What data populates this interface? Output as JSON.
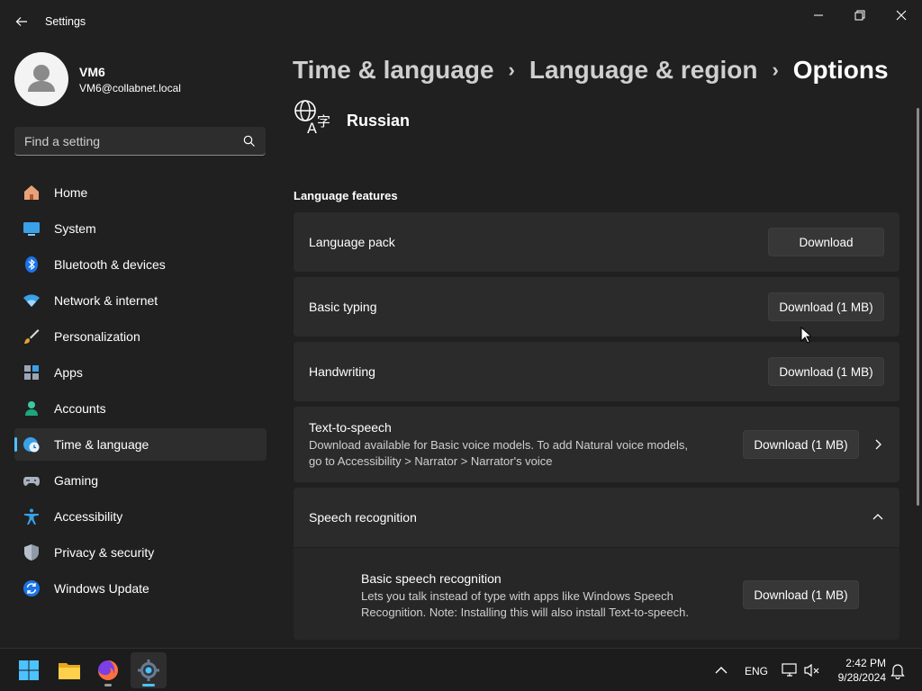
{
  "window": {
    "title": "Settings"
  },
  "profile": {
    "name": "VM6",
    "email": "VM6@collabnet.local"
  },
  "search": {
    "placeholder": "Find a setting"
  },
  "sidebar": {
    "items": [
      {
        "label": "Home",
        "icon": "home-icon"
      },
      {
        "label": "System",
        "icon": "system-icon"
      },
      {
        "label": "Bluetooth & devices",
        "icon": "bluetooth-icon"
      },
      {
        "label": "Network & internet",
        "icon": "wifi-icon"
      },
      {
        "label": "Personalization",
        "icon": "brush-icon"
      },
      {
        "label": "Apps",
        "icon": "apps-icon"
      },
      {
        "label": "Accounts",
        "icon": "accounts-icon"
      },
      {
        "label": "Time & language",
        "icon": "time-language-icon",
        "selected": true
      },
      {
        "label": "Gaming",
        "icon": "gamepad-icon"
      },
      {
        "label": "Accessibility",
        "icon": "accessibility-icon"
      },
      {
        "label": "Privacy & security",
        "icon": "shield-icon"
      },
      {
        "label": "Windows Update",
        "icon": "update-icon"
      }
    ]
  },
  "breadcrumb": {
    "items": [
      "Time & language",
      "Language & region"
    ],
    "current": "Options",
    "separator": "›"
  },
  "language": {
    "name": "Russian"
  },
  "features": {
    "section_title": "Language features",
    "language_pack": {
      "label": "Language pack",
      "button": "Download"
    },
    "basic_typing": {
      "label": "Basic typing",
      "button": "Download (1 MB)"
    },
    "handwriting": {
      "label": "Handwriting",
      "button": "Download (1 MB)"
    },
    "tts": {
      "label": "Text-to-speech",
      "desc_line1": "Download available for Basic voice models. To add Natural voice models,",
      "desc_line2": "go to Accessibility > Narrator > Narrator's voice",
      "button": "Download (1 MB)"
    },
    "speech": {
      "label": "Speech recognition",
      "expanded": true,
      "basic": {
        "label": "Basic speech recognition",
        "desc_line1": "Lets you talk instead of type with apps like Windows Speech",
        "desc_line2": "Recognition. Note: Installing this will also install Text-to-speech.",
        "button": "Download (1 MB)"
      }
    }
  },
  "taskbar": {
    "apps": [
      "start-icon",
      "file-explorer-icon",
      "firefox-icon",
      "settings-icon"
    ],
    "tray": {
      "lang": "ENG",
      "time": "2:42 PM",
      "date": "9/28/2024"
    }
  },
  "colors": {
    "background": "#202020",
    "card": "#2b2b2b",
    "accent": "#4cc2ff"
  }
}
